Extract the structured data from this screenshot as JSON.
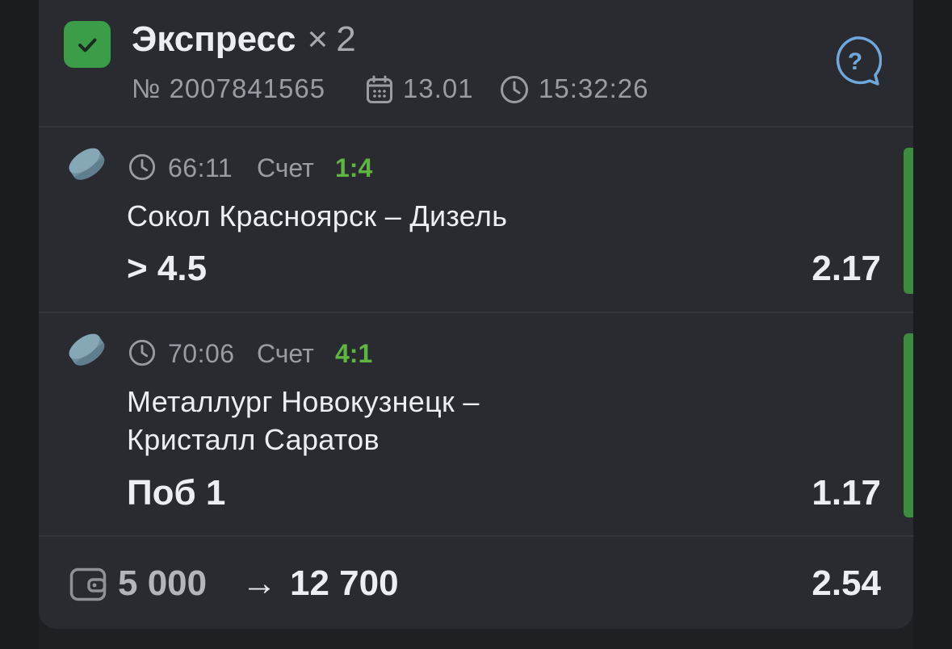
{
  "header": {
    "title": "Экспресс",
    "multiplier_sign": "×",
    "count": "2",
    "bet_number": "№ 2007841565",
    "date": "13.01",
    "time": "15:32:26",
    "help_symbol": "?"
  },
  "events": [
    {
      "sport_icon": "hockey-puck-icon",
      "game_time": "66:11",
      "score_label": "Счет",
      "score": "1:4",
      "match_line1": "Сокол Красноярск – Дизель",
      "match_line2": "",
      "pick": "> 4.5",
      "odds": "2.17"
    },
    {
      "sport_icon": "hockey-puck-icon",
      "game_time": "70:06",
      "score_label": "Счет",
      "score": "4:1",
      "match_line1": "Металлург Новокузнецк –",
      "match_line2": "Кристалл Саратов",
      "pick": "Поб 1",
      "odds": "1.17"
    }
  ],
  "footer": {
    "stake": "5 000",
    "arrow": "→",
    "payout": "12 700",
    "total_odds": "2.54"
  },
  "colors": {
    "accent_green": "#3b9d47",
    "score_green": "#5eb640",
    "help_blue": "#6fa8dc",
    "puck": "#7a9bab"
  }
}
